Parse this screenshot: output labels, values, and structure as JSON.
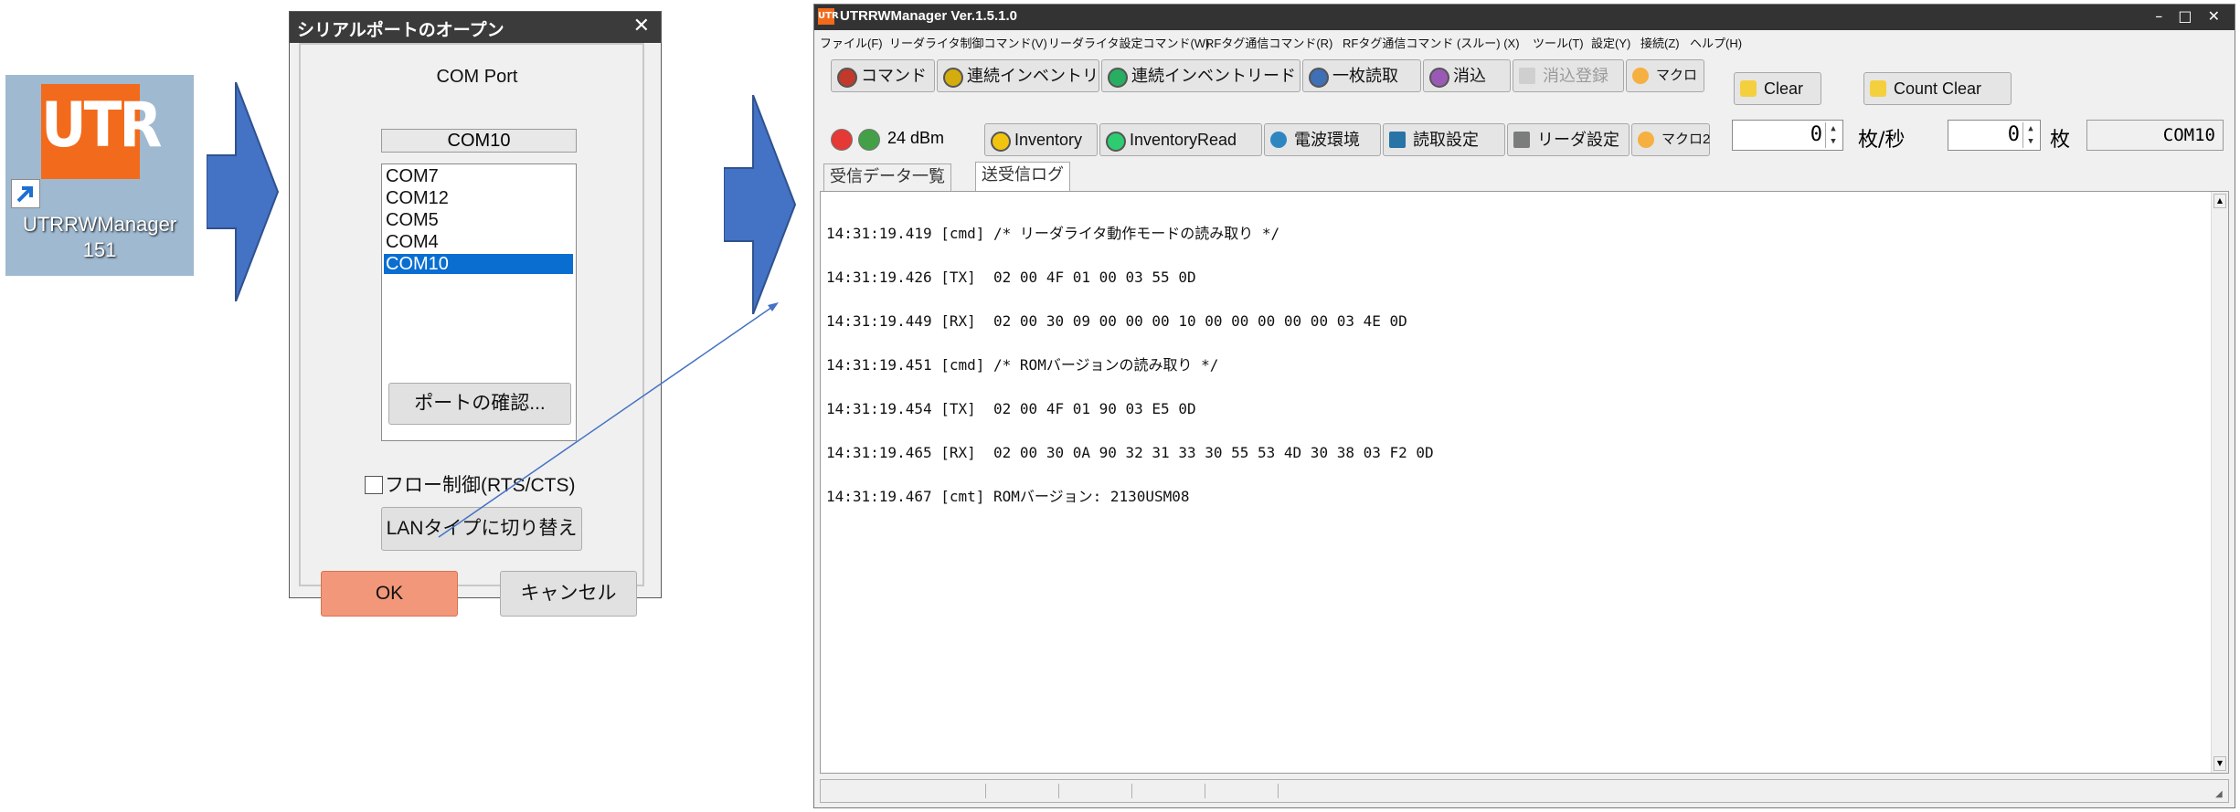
{
  "shortcut": {
    "logo_text": "UTR",
    "label_line1": "UTRRWManager",
    "label_line2": "151"
  },
  "dialog": {
    "title": "シリアルポートのオープン",
    "close_glyph": "✕",
    "com_caption": "COM Port",
    "com_current": "COM10",
    "ports": [
      {
        "label": "COM7",
        "selected": false
      },
      {
        "label": "COM12",
        "selected": false
      },
      {
        "label": "COM5",
        "selected": false
      },
      {
        "label": "COM4",
        "selected": false
      },
      {
        "label": "COM10",
        "selected": true
      }
    ],
    "confirm_label": "ポートの確認...",
    "flow_label": "フロー制御(RTS/CTS)",
    "lan_label": "LANタイプに切り替え",
    "ok_label": "OK",
    "cancel_label": "キャンセル"
  },
  "app": {
    "title": "UTRRWManager Ver.1.5.1.0",
    "logo_text": "UTR",
    "window_controls": "– □ ✕",
    "menu": [
      "ファイル(F)",
      "リーダライタ制御コマンド(V)",
      "リーダライタ設定コマンド(W)",
      "RFタグ通信コマンド(R)",
      "RFタグ通信コマンド (スルー) (X)",
      "ツール(T)",
      "設定(Y)",
      "接続(Z)",
      "ヘルプ(H)"
    ],
    "toolbar1": [
      "コマンド",
      "連続インベントリ",
      "連続インベントリード",
      "一枚読取",
      "消込",
      "消込登録",
      "マクロ"
    ],
    "toolbar2": {
      "power": "24 dBm",
      "buttons": [
        "Inventory",
        "InventoryRead",
        "電波環境",
        "読取設定",
        "リーダ設定",
        "マクロ2"
      ]
    },
    "clear_label": "Clear",
    "count_clear_label": "Count Clear",
    "rate_value": "0",
    "rate_unit": "枚/秒",
    "count_value": "0",
    "count_unit": "枚",
    "port_display": "COM10",
    "tabs": [
      "受信データ一覧",
      "送受信ログ"
    ],
    "log_lines": [
      "14:31:19.419 [cmd] /* リーダライタ動作モードの読み取り */",
      "14:31:19.426 [TX]  02 00 4F 01 00 03 55 0D",
      "14:31:19.449 [RX]  02 00 30 09 00 00 00 10 00 00 00 00 00 03 4E 0D",
      "14:31:19.451 [cmd] /* ROMバージョンの読み取り */",
      "14:31:19.454 [TX]  02 00 4F 01 90 03 E5 0D",
      "14:31:19.465 [RX]  02 00 30 0A 90 32 31 33 30 55 53 4D 30 38 03 F2 0D",
      "14:31:19.467 [cmt] ROMバージョン: 2130USM08"
    ]
  },
  "colors": {
    "utr_orange": "#f26a1b",
    "arrow_blue": "#4472c4",
    "selection": "#0a6ed1",
    "ok_button": "#f2977a"
  }
}
